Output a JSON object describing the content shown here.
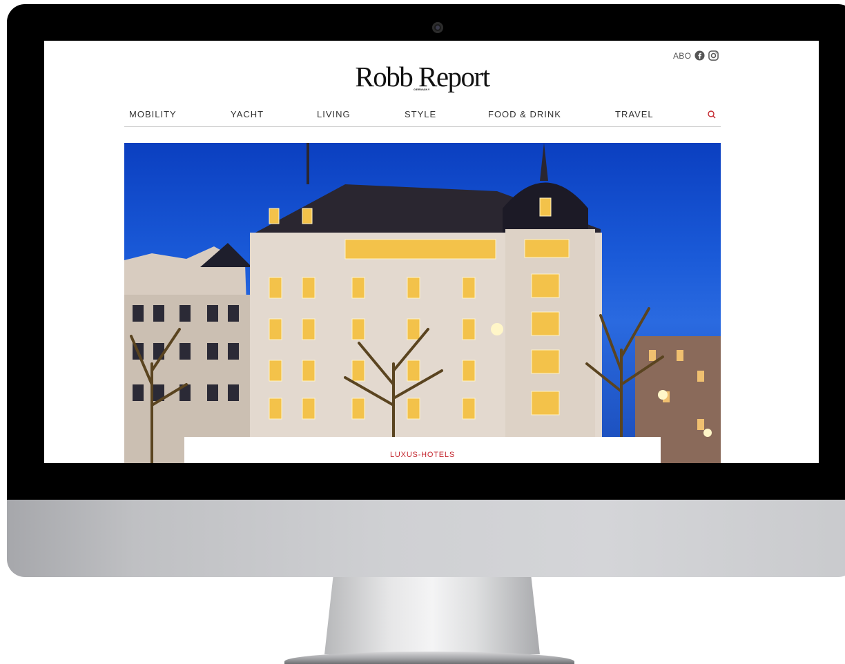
{
  "header": {
    "abo_label": "ABO",
    "logo_text": "Robb Report",
    "logo_subtext": "GERMANY",
    "social_icons": [
      "facebook-icon",
      "instagram-icon"
    ]
  },
  "nav": {
    "items": [
      {
        "label": "MOBILITY"
      },
      {
        "label": "YACHT"
      },
      {
        "label": "LIVING"
      },
      {
        "label": "STYLE"
      },
      {
        "label": "FOOD & DRINK"
      },
      {
        "label": "TRAVEL"
      }
    ],
    "search_icon": "search-icon"
  },
  "hero": {
    "kicker": "LUXUS-HOTELS"
  },
  "colors": {
    "accent": "#c4262e",
    "sky": "#1a5ad8",
    "bezel": "#000000"
  }
}
